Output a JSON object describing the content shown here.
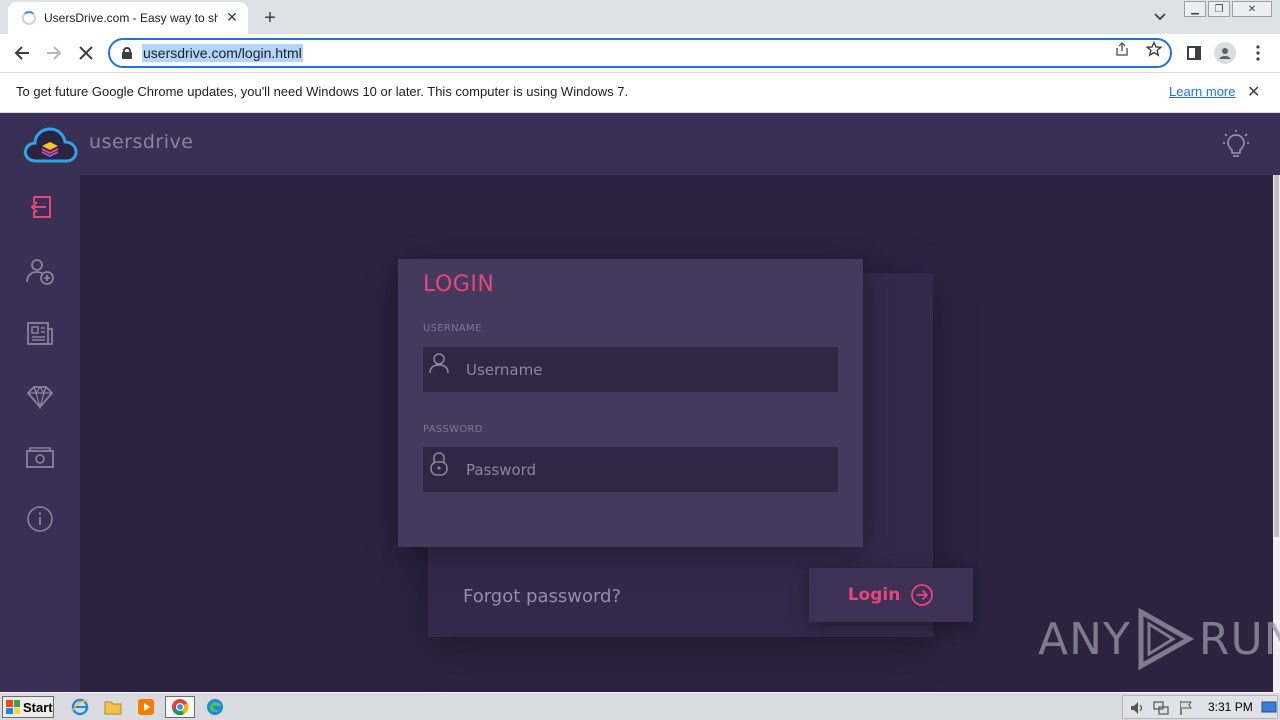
{
  "browser": {
    "tab_title": "UsersDrive.com - Easy way to share",
    "url": "usersdrive.com/login.html",
    "infobar_message": "To get future Google Chrome updates, you'll need Windows 10 or later. This computer is using Windows 7.",
    "infobar_link": "Learn more",
    "accent_color": "#1a73e8"
  },
  "site": {
    "brand": "usersdrive",
    "accent_color": "#e8457a",
    "sidebar": [
      {
        "name": "sign-in-icon",
        "active": true
      },
      {
        "name": "add-user-icon"
      },
      {
        "name": "news-icon"
      },
      {
        "name": "diamond-icon"
      },
      {
        "name": "cash-icon"
      },
      {
        "name": "info-icon"
      }
    ]
  },
  "login": {
    "title": "LOGIN",
    "username_label": "USERNAME",
    "username_placeholder": "Username",
    "password_label": "PASSWORD",
    "password_placeholder": "Password",
    "forgot": "Forgot password?",
    "submit": "Login"
  },
  "watermark": {
    "left": "ANY",
    "right": "RUN"
  },
  "taskbar": {
    "start": "Start",
    "clock": "3:31 PM"
  }
}
